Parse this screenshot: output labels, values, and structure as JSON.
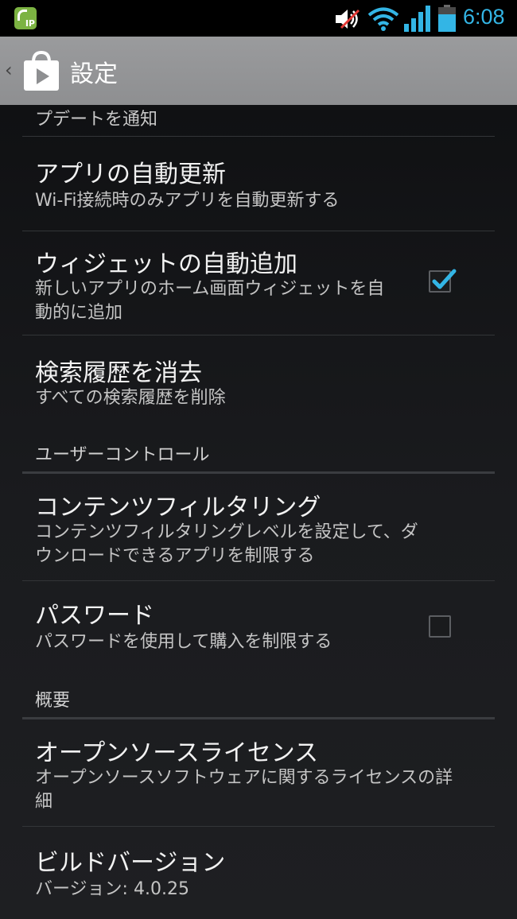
{
  "status_bar": {
    "time": "6:08",
    "notification_badge": "IP",
    "icons": [
      "notification-app-icon",
      "volume-muted-icon",
      "wifi-icon",
      "signal-icon",
      "battery-icon"
    ],
    "accent_color": "#33b5e5"
  },
  "action_bar": {
    "title": "設定",
    "up_caret": "‹"
  },
  "list": {
    "partial_item_text": "プデートを通知",
    "items": [
      {
        "title": "アプリの自動更新",
        "summary": "Wi-Fi接続時のみアプリを自動更新する"
      },
      {
        "title": "ウィジェットの自動追加",
        "summary": "新しいアプリのホーム画面ウィジェットを自動的に追加",
        "checked": true
      },
      {
        "title": "検索履歴を消去",
        "summary": "すべての検索履歴を削除"
      }
    ],
    "categories": [
      {
        "label": "ユーザーコントロール",
        "items": [
          {
            "title": "コンテンツフィルタリング",
            "summary": "コンテンツフィルタリングレベルを設定して、ダウンロードできるアプリを制限する"
          },
          {
            "title": "パスワード",
            "summary": "パスワードを使用して購入を制限する",
            "checked": false
          }
        ]
      },
      {
        "label": "概要",
        "items": [
          {
            "title": "オープンソースライセンス",
            "summary": "オープンソースソフトウェアに関するライセンスの詳細"
          },
          {
            "title": "ビルドバージョン",
            "summary": "バージョン: 4.0.25"
          }
        ]
      }
    ]
  }
}
